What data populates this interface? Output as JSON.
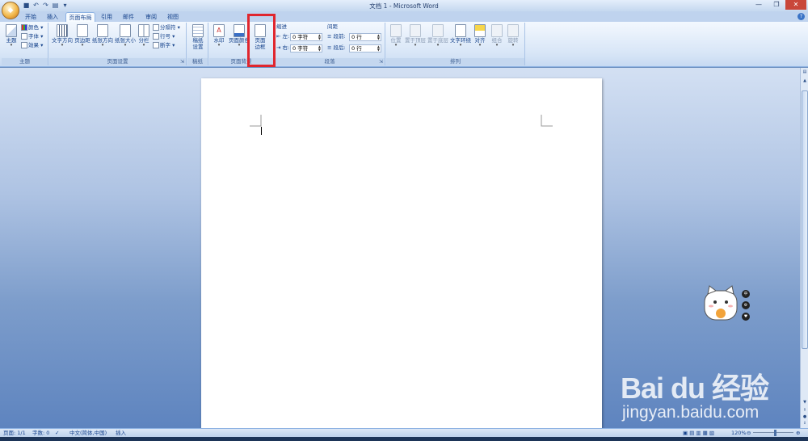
{
  "window": {
    "title": "文档 1 - Microsoft Word"
  },
  "quick_access": [
    "save-icon",
    "undo-icon",
    "redo-icon",
    "print-preview-icon"
  ],
  "tabs": [
    {
      "label": "开始",
      "active": false
    },
    {
      "label": "插入",
      "active": false
    },
    {
      "label": "页面布局",
      "active": true
    },
    {
      "label": "引用",
      "active": false
    },
    {
      "label": "邮件",
      "active": false
    },
    {
      "label": "审阅",
      "active": false
    },
    {
      "label": "视图",
      "active": false
    }
  ],
  "ribbon": {
    "theme": {
      "group_label": "主题",
      "theme_btn": "主题",
      "colors": "颜色",
      "fonts": "字体",
      "effects": "效果"
    },
    "page_setup": {
      "group_label": "页面设置",
      "text_direction": "文字方向",
      "margins": "页边距",
      "orientation": "纸张方向",
      "size": "纸张大小",
      "columns": "分栏",
      "breaks": "分隔符",
      "line_numbers": "行号",
      "hyphenation": "断字"
    },
    "manuscript": {
      "group_label": "稿纸",
      "setup": "稿纸\n设置"
    },
    "page_background": {
      "group_label": "页面背景",
      "watermark": "水印",
      "page_color": "页面颜色",
      "page_borders": "页面\n边框"
    },
    "paragraph": {
      "group_label": "段落",
      "indent_title": "缩进",
      "indent_left_label": "左:",
      "indent_left_value": "0 字符",
      "indent_right_label": "右:",
      "indent_right_value": "0 字符",
      "spacing_title": "间距",
      "spacing_before_label": "段前:",
      "spacing_before_value": "0 行",
      "spacing_after_label": "段后:",
      "spacing_after_value": "0 行"
    },
    "arrange": {
      "group_label": "排列",
      "position": "位置",
      "bring_front": "置于顶层",
      "send_back": "置于底层",
      "text_wrap": "文字环绕",
      "align": "对齐",
      "group": "组合",
      "rotate": "旋转"
    }
  },
  "status": {
    "page": "页面: 1/1",
    "words": "字数: 0",
    "language": "中文(简体,中国)",
    "mode": "插入",
    "zoom": "120%"
  },
  "watermark": {
    "logo": "Bai du 经验",
    "url": "jingyan.baidu.com"
  }
}
